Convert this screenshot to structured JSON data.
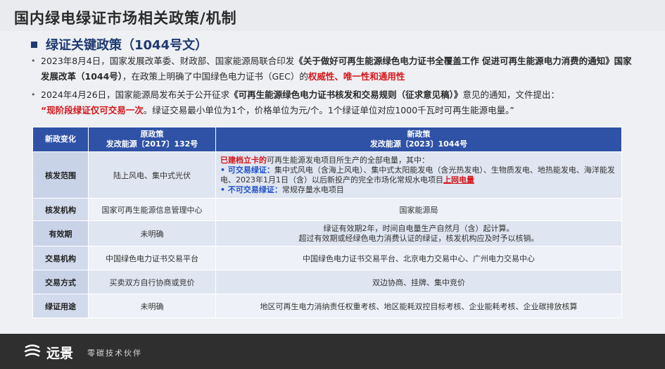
{
  "page_title": "国内绿电绿证市场相关政策/机制",
  "section_title": "绿证关键政策（1044号文）",
  "p1": {
    "a": "2023年8月4日，国家发展改革委、财政部、国家能源局联合印发",
    "b": "《关于做好可再生能源绿色电力证书全覆盖工作 促进可再生能源电力消费的通知》国家发展改革（1044号）",
    "c": "，在政策上明确了中国绿色电力证书（GEC）的",
    "d": "权威性、唯一性和通用性"
  },
  "p2": {
    "a": "2024年4月26日，国家能源局发布关于公开征求",
    "b": "《可再生能源绿色电力证书核发和交易规则（征求意见稿）》",
    "c": "意见的通知，文件提出：",
    "d": "“现阶段绿证仅可交易一次",
    "e": "。绿证交易最小单位为1个，价格单位为元/个。1个绿证单位对应1000千瓦时可再生能源电量。”"
  },
  "table": {
    "h1": "新政变化",
    "h2a": "原政策",
    "h2b": "发改能源〔2017〕132号",
    "h3a": "新政策",
    "h3b": "发改能源〔2023〕1044号",
    "r1": {
      "k": "核发范围",
      "o": "陆上风电、集中式光伏",
      "n1r": "已建档立卡的",
      "n1": "可再生能源发电项目所生产的全部电量，其中：",
      "n2b": "• 可交易绿证：",
      "n2": "集中式风电（含海上风电）、集中式太阳能发电（含光热发电）、生物质发电、地热能发电、海洋能发电、2023年1月1日（含）以后新投产的完全市场化常规水电项目",
      "n2r": "上网电量",
      "n3b": "• 不可交易绿证：",
      "n3": "常规存量水电项目"
    },
    "r2": {
      "k": "核发机构",
      "o": "国家可再生能源信息管理中心",
      "n": "国家能源局"
    },
    "r3": {
      "k": "有效期",
      "o": "未明确",
      "n1": "绿证有效期2年，时间自电量生产自然月（含）起计算。",
      "n2": "超过有效期或经绿色电力消费认证的绿证，核发机构应及时予以核销。"
    },
    "r4": {
      "k": "交易机构",
      "o": "中国绿色电力证书交易平台",
      "n": "中国绿色电力证书交易平台、北京电力交易中心、广州电力交易中心"
    },
    "r5": {
      "k": "交易方式",
      "o": "买卖双方自行协商或竞价",
      "n": "双边协商、挂牌、集中竞价"
    },
    "r6": {
      "k": "绿证用途",
      "o": "未明确",
      "n": "地区可再生电力消纳责任权重考核、地区能耗双控目标考核、企业能耗考核、企业碳排放核算"
    }
  },
  "footer": {
    "brand": "远景",
    "tagline": "零碳技术伙伴",
    "logo_icon": "envision-logo-icon"
  },
  "colors": {
    "accent": "#1f3a70",
    "header_blue": "#2f52a6",
    "red": "#d6161b",
    "footer_bg": "#2f2f30"
  }
}
